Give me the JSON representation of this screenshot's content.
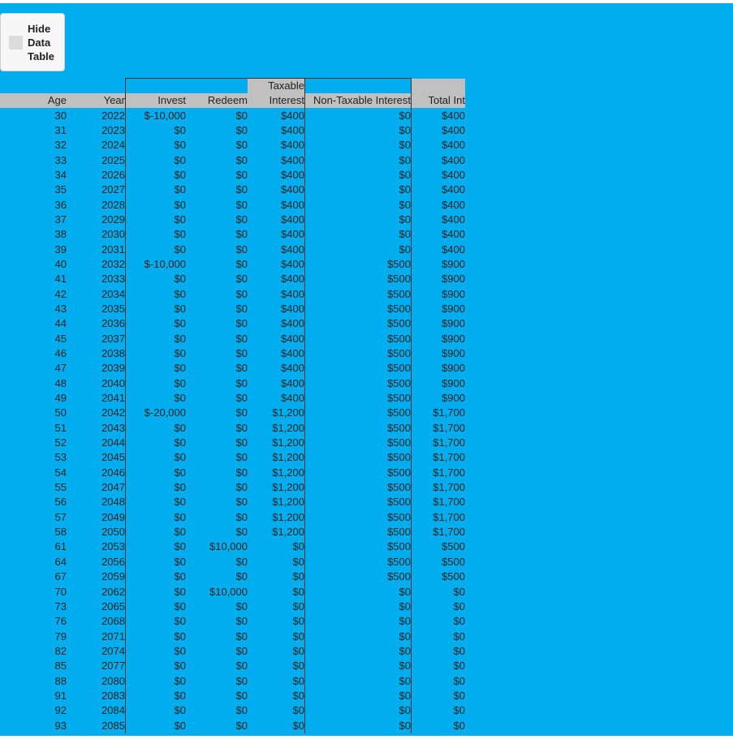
{
  "toggle_label": "Hide\nData\nTable",
  "columns": {
    "age": "Age",
    "year": "Year",
    "invest": "Invest",
    "redeem": "Redeem",
    "taxable_top": "Taxable",
    "taxable_bottom": "Interest",
    "non_taxable": "Non-Taxable Interest",
    "total": "Total Int"
  },
  "rows": [
    [
      "30",
      "2022",
      "$-10,000",
      "$0",
      "$400",
      "$0",
      "$400"
    ],
    [
      "31",
      "2023",
      "$0",
      "$0",
      "$400",
      "$0",
      "$400"
    ],
    [
      "32",
      "2024",
      "$0",
      "$0",
      "$400",
      "$0",
      "$400"
    ],
    [
      "33",
      "2025",
      "$0",
      "$0",
      "$400",
      "$0",
      "$400"
    ],
    [
      "34",
      "2026",
      "$0",
      "$0",
      "$400",
      "$0",
      "$400"
    ],
    [
      "35",
      "2027",
      "$0",
      "$0",
      "$400",
      "$0",
      "$400"
    ],
    [
      "36",
      "2028",
      "$0",
      "$0",
      "$400",
      "$0",
      "$400"
    ],
    [
      "37",
      "2029",
      "$0",
      "$0",
      "$400",
      "$0",
      "$400"
    ],
    [
      "38",
      "2030",
      "$0",
      "$0",
      "$400",
      "$0",
      "$400"
    ],
    [
      "39",
      "2031",
      "$0",
      "$0",
      "$400",
      "$0",
      "$400"
    ],
    [
      "40",
      "2032",
      "$-10,000",
      "$0",
      "$400",
      "$500",
      "$900"
    ],
    [
      "41",
      "2033",
      "$0",
      "$0",
      "$400",
      "$500",
      "$900"
    ],
    [
      "42",
      "2034",
      "$0",
      "$0",
      "$400",
      "$500",
      "$900"
    ],
    [
      "43",
      "2035",
      "$0",
      "$0",
      "$400",
      "$500",
      "$900"
    ],
    [
      "44",
      "2036",
      "$0",
      "$0",
      "$400",
      "$500",
      "$900"
    ],
    [
      "45",
      "2037",
      "$0",
      "$0",
      "$400",
      "$500",
      "$900"
    ],
    [
      "46",
      "2038",
      "$0",
      "$0",
      "$400",
      "$500",
      "$900"
    ],
    [
      "47",
      "2039",
      "$0",
      "$0",
      "$400",
      "$500",
      "$900"
    ],
    [
      "48",
      "2040",
      "$0",
      "$0",
      "$400",
      "$500",
      "$900"
    ],
    [
      "49",
      "2041",
      "$0",
      "$0",
      "$400",
      "$500",
      "$900"
    ],
    [
      "50",
      "2042",
      "$-20,000",
      "$0",
      "$1,200",
      "$500",
      "$1,700"
    ],
    [
      "51",
      "2043",
      "$0",
      "$0",
      "$1,200",
      "$500",
      "$1,700"
    ],
    [
      "52",
      "2044",
      "$0",
      "$0",
      "$1,200",
      "$500",
      "$1,700"
    ],
    [
      "53",
      "2045",
      "$0",
      "$0",
      "$1,200",
      "$500",
      "$1,700"
    ],
    [
      "54",
      "2046",
      "$0",
      "$0",
      "$1,200",
      "$500",
      "$1,700"
    ],
    [
      "55",
      "2047",
      "$0",
      "$0",
      "$1,200",
      "$500",
      "$1,700"
    ],
    [
      "56",
      "2048",
      "$0",
      "$0",
      "$1,200",
      "$500",
      "$1,700"
    ],
    [
      "57",
      "2049",
      "$0",
      "$0",
      "$1,200",
      "$500",
      "$1,700"
    ],
    [
      "58",
      "2050",
      "$0",
      "$0",
      "$1,200",
      "$500",
      "$1,700"
    ],
    [
      "61",
      "2053",
      "$0",
      "$10,000",
      "$0",
      "$500",
      "$500"
    ],
    [
      "64",
      "2056",
      "$0",
      "$0",
      "$0",
      "$500",
      "$500"
    ],
    [
      "67",
      "2059",
      "$0",
      "$0",
      "$0",
      "$500",
      "$500"
    ],
    [
      "70",
      "2062",
      "$0",
      "$10,000",
      "$0",
      "$0",
      "$0"
    ],
    [
      "73",
      "2065",
      "$0",
      "$0",
      "$0",
      "$0",
      "$0"
    ],
    [
      "76",
      "2068",
      "$0",
      "$0",
      "$0",
      "$0",
      "$0"
    ],
    [
      "79",
      "2071",
      "$0",
      "$0",
      "$0",
      "$0",
      "$0"
    ],
    [
      "82",
      "2074",
      "$0",
      "$0",
      "$0",
      "$0",
      "$0"
    ],
    [
      "85",
      "2077",
      "$0",
      "$0",
      "$0",
      "$0",
      "$0"
    ],
    [
      "88",
      "2080",
      "$0",
      "$0",
      "$0",
      "$0",
      "$0"
    ],
    [
      "91",
      "2083",
      "$0",
      "$0",
      "$0",
      "$0",
      "$0"
    ],
    [
      "92",
      "2084",
      "$0",
      "$0",
      "$0",
      "$0",
      "$0"
    ],
    [
      "93",
      "2085",
      "$0",
      "$0",
      "$0",
      "$0",
      "$0"
    ]
  ]
}
